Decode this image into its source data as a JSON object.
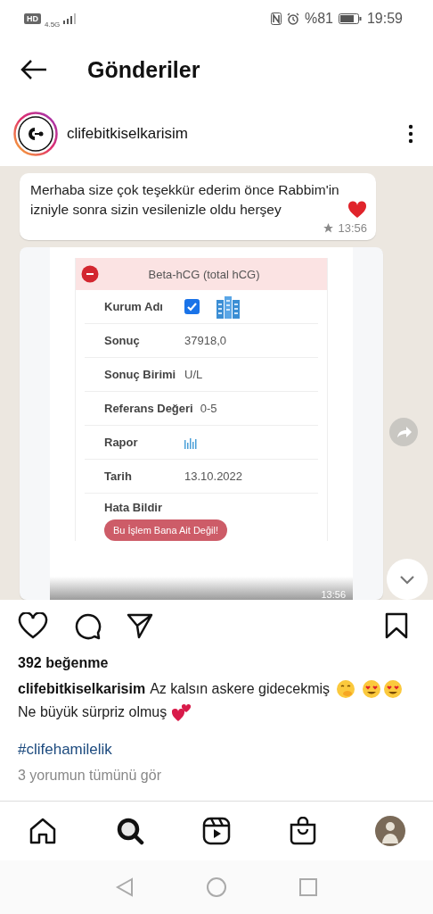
{
  "status_bar": {
    "hd": "HD",
    "network": "4.5G",
    "battery": "%81",
    "time": "19:59"
  },
  "header": {
    "title": "Gönderiler"
  },
  "post": {
    "username": "clifebitkiselkarisim",
    "image": {
      "message": {
        "text": "Merhaba size çok teşekkür ederim önce Rabbim'in izniyle sonra sizin vesilenizle oldu herşey",
        "time": "13:56",
        "starred": true
      },
      "report": {
        "title": "Beta-hCG (total hCG)",
        "rows": [
          {
            "kind": "checkbox",
            "label": "Kurum Adı",
            "checked": true
          },
          {
            "kind": "text",
            "label": "Sonuç",
            "value": "37918,0"
          },
          {
            "kind": "text",
            "label": "Sonuç Birimi",
            "value": "U/L"
          },
          {
            "kind": "text",
            "label": "Referans Değeri",
            "value": "0-5"
          },
          {
            "kind": "chart",
            "label": "Rapor"
          },
          {
            "kind": "text",
            "label": "Tarih",
            "value": "13.10.2022"
          },
          {
            "kind": "button",
            "label": "Hata Bildir",
            "value": "Bu İşlem Bana Ait Değil!"
          }
        ],
        "time": "13:56"
      }
    },
    "likes": "392 beğenme",
    "caption": {
      "username": "clifebitkiselkarisim",
      "text_1": "Az kalsın askere gidecekmiş",
      "text_2": "Ne büyük sürpriz olmuş"
    },
    "hashtag": "#clifehamilelik",
    "comments": "3 yorumun tümünü gör"
  },
  "bottom_nav": [
    {
      "kind": "home",
      "selected": false
    },
    {
      "kind": "search",
      "selected": true
    },
    {
      "kind": "reels",
      "selected": false
    },
    {
      "kind": "shop",
      "selected": false
    },
    {
      "kind": "profile",
      "selected": false
    }
  ]
}
